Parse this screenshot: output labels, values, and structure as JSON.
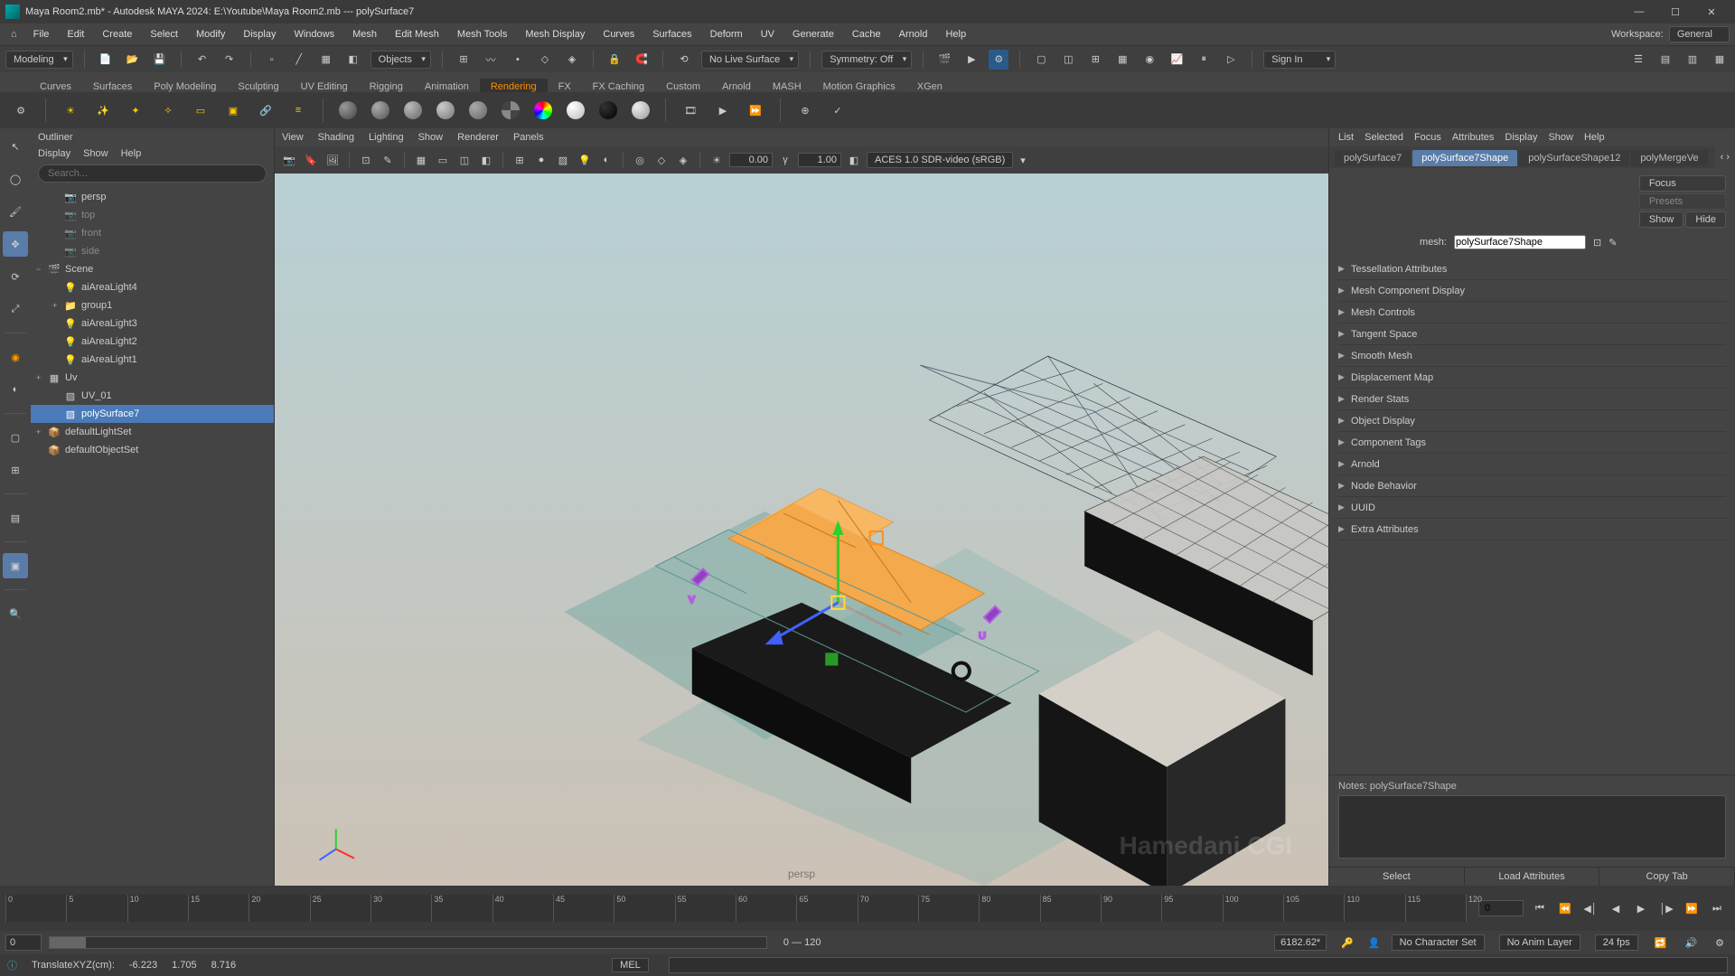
{
  "titlebar": {
    "text": "Maya Room2.mb* - Autodesk MAYA 2024: E:\\Youtube\\Maya Room2.mb  ---  polySurface7"
  },
  "menubar": {
    "items": [
      "File",
      "Edit",
      "Create",
      "Select",
      "Modify",
      "Display",
      "Windows",
      "Mesh",
      "Edit Mesh",
      "Mesh Tools",
      "Mesh Display",
      "Curves",
      "Surfaces",
      "Deform",
      "UV",
      "Generate",
      "Cache",
      "Arnold",
      "Help"
    ],
    "workspace_label": "Workspace:",
    "workspace_value": "General"
  },
  "shelfbar": {
    "mode": "Modeling",
    "objects_btn": "Objects",
    "livesurface": "No Live Surface",
    "symmetry": "Symmetry: Off",
    "signin": "Sign In"
  },
  "shelf_tabs": [
    "Curves",
    "Surfaces",
    "Poly Modeling",
    "Sculpting",
    "UV Editing",
    "Rigging",
    "Animation",
    "Rendering",
    "FX",
    "FX Caching",
    "Custom",
    "Arnold",
    "MASH",
    "Motion Graphics",
    "XGen"
  ],
  "shelf_tab_active": 7,
  "outliner": {
    "title": "Outliner",
    "menu": [
      "Display",
      "Show",
      "Help"
    ],
    "search_ph": "Search...",
    "rows": [
      {
        "depth": 1,
        "exp": "",
        "icon": "camera",
        "label": "persp"
      },
      {
        "depth": 1,
        "exp": "",
        "icon": "camera-dim",
        "label": "top",
        "dim": true
      },
      {
        "depth": 1,
        "exp": "",
        "icon": "camera-dim",
        "label": "front",
        "dim": true
      },
      {
        "depth": 1,
        "exp": "",
        "icon": "camera-dim",
        "label": "side",
        "dim": true
      },
      {
        "depth": 0,
        "exp": "−",
        "icon": "scene",
        "label": "Scene"
      },
      {
        "depth": 1,
        "exp": "",
        "icon": "light",
        "label": "aiAreaLight4"
      },
      {
        "depth": 1,
        "exp": "+",
        "icon": "group",
        "label": "group1"
      },
      {
        "depth": 1,
        "exp": "",
        "icon": "light",
        "label": "aiAreaLight3"
      },
      {
        "depth": 1,
        "exp": "",
        "icon": "light",
        "label": "aiAreaLight2"
      },
      {
        "depth": 1,
        "exp": "",
        "icon": "light",
        "label": "aiAreaLight1"
      },
      {
        "depth": 0,
        "exp": "+",
        "icon": "uv",
        "label": "Uv"
      },
      {
        "depth": 1,
        "exp": "",
        "icon": "mesh",
        "label": "UV_01"
      },
      {
        "depth": 1,
        "exp": "",
        "icon": "mesh-sel",
        "label": "polySurface7",
        "selected": true
      },
      {
        "depth": 0,
        "exp": "+",
        "icon": "set",
        "label": "defaultLightSet"
      },
      {
        "depth": 0,
        "exp": "",
        "icon": "set",
        "label": "defaultObjectSet"
      }
    ]
  },
  "vp_menu": [
    "View",
    "Shading",
    "Lighting",
    "Show",
    "Renderer",
    "Panels"
  ],
  "vp_toolbar": {
    "num1": "0.00",
    "num2": "1.00",
    "colorspace": "ACES 1.0 SDR-video (sRGB)"
  },
  "viewport": {
    "camera": "persp",
    "watermark": "Hamedani CGI"
  },
  "attr": {
    "menu": [
      "List",
      "Selected",
      "Focus",
      "Attributes",
      "Display",
      "Show",
      "Help"
    ],
    "tabs": [
      "polySurface7",
      "polySurface7Shape",
      "polySurfaceShape12",
      "polyMergeVe"
    ],
    "tab_active": 1,
    "focus": "Focus",
    "presets": "Presets",
    "show": "Show",
    "hide": "Hide",
    "mesh_label": "mesh:",
    "mesh_value": "polySurface7Shape",
    "sections": [
      "Tessellation Attributes",
      "Mesh Component Display",
      "Mesh Controls",
      "Tangent Space",
      "Smooth Mesh",
      "Displacement Map",
      "Render Stats",
      "Object Display",
      "Component Tags",
      "Arnold",
      "Node Behavior",
      "UUID",
      "Extra Attributes"
    ],
    "notes_label": "Notes:  polySurface7Shape",
    "footer": [
      "Select",
      "Load Attributes",
      "Copy Tab"
    ]
  },
  "timeline": {
    "ticks": [
      0,
      5,
      10,
      15,
      20,
      25,
      30,
      35,
      40,
      45,
      50,
      55,
      60,
      65,
      70,
      75,
      80,
      85,
      90,
      95,
      100,
      105,
      110,
      115,
      120
    ],
    "frame": "0"
  },
  "range": {
    "start": "0",
    "range": "0 — 120",
    "shot": "6182.62*",
    "charset": "No Character Set",
    "animlayer": "No Anim Layer",
    "fps": "24 fps"
  },
  "status": {
    "tool": "TranslateXYZ(cm):",
    "x": "-6.223",
    "y": "1.705",
    "z": "8.716",
    "mel": "MEL"
  }
}
